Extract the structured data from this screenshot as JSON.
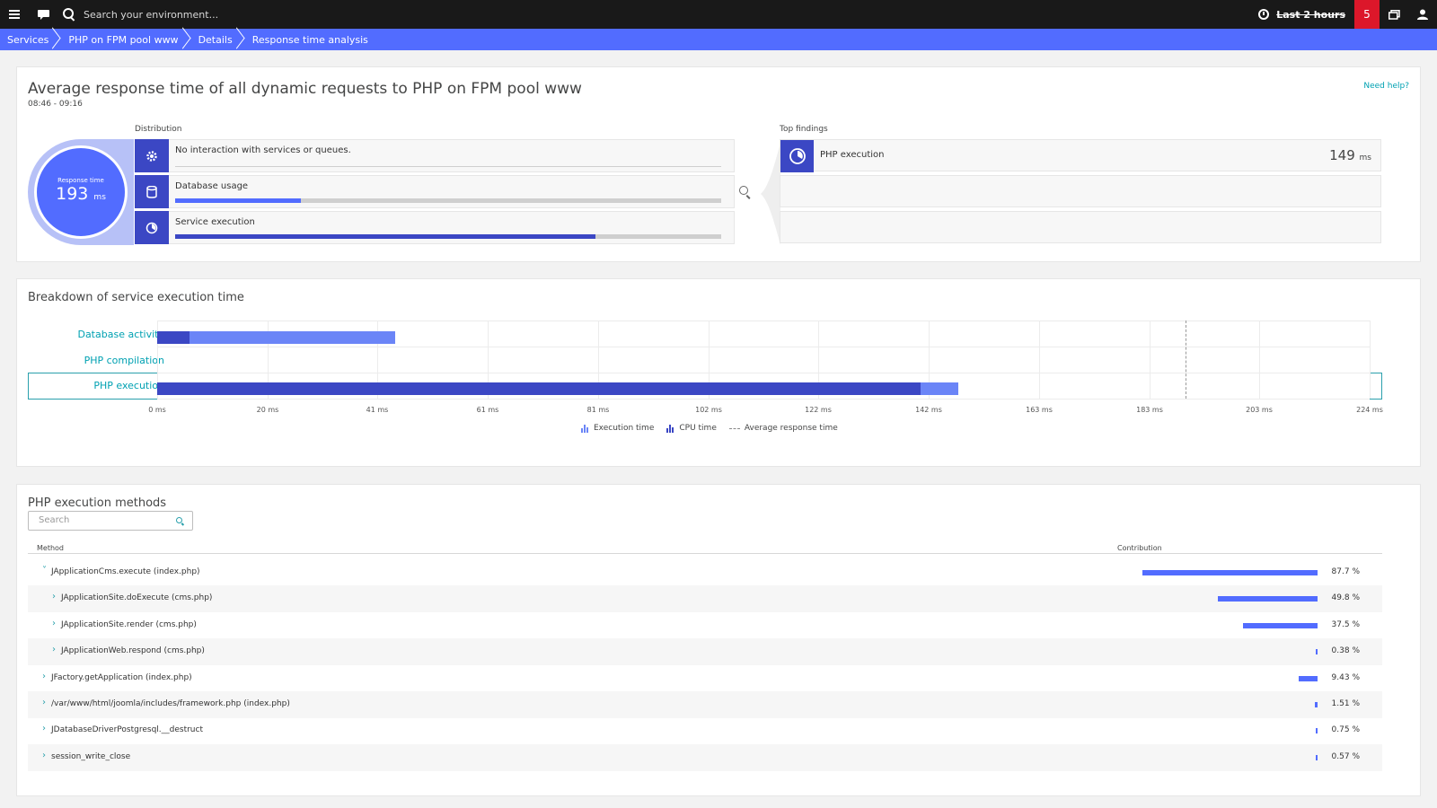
{
  "topbar": {
    "search_placeholder": "Search your environment...",
    "timeframe": "Last 2 hours",
    "problems_count": "5"
  },
  "breadcrumb": [
    "Services",
    "PHP on FPM pool www",
    "Details",
    "Response time analysis"
  ],
  "summary": {
    "title": "Average response time of all dynamic requests to PHP on FPM pool www",
    "time_range": "08:46 - 09:16",
    "help_link": "Need help?",
    "response_time_label": "Response time",
    "response_time_value": "193",
    "response_time_unit": "ms",
    "distribution_label": "Distribution",
    "distribution": [
      {
        "label": "No interaction with services or queues.",
        "icon": "gear-icon",
        "fraction": 0
      },
      {
        "label": "Database usage",
        "icon": "database-icon",
        "fraction": 0.23
      },
      {
        "label": "Service execution",
        "icon": "timer-icon",
        "fraction": 0.77
      }
    ],
    "top_findings_label": "Top findings",
    "top_findings": [
      {
        "label": "PHP execution",
        "value": "149",
        "unit": "ms",
        "icon": "timer-icon"
      }
    ]
  },
  "breakdown": {
    "title": "Breakdown of service execution time",
    "chart_data": {
      "type": "bar",
      "orientation": "horizontal",
      "stacked": true,
      "categories": [
        "Database activity",
        "PHP compilation",
        "PHP execution"
      ],
      "series": [
        {
          "name": "Execution time",
          "color": "#3b47c4",
          "values": [
            6,
            0,
            141
          ]
        },
        {
          "name": "CPU time",
          "color": "#6b85f7",
          "values": [
            38,
            0,
            7
          ]
        }
      ],
      "avg_response_time": 190,
      "xlim": [
        0,
        224
      ],
      "x_ticks": [
        "0 ms",
        "20 ms",
        "41 ms",
        "61 ms",
        "81 ms",
        "102 ms",
        "122 ms",
        "142 ms",
        "163 ms",
        "183 ms",
        "203 ms",
        "224 ms"
      ],
      "selected_category": "PHP execution",
      "legend": [
        "Execution time",
        "CPU time",
        "Average response time"
      ],
      "legend_position": "bottom"
    }
  },
  "methods": {
    "title": "PHP execution methods",
    "search_placeholder": "Search",
    "col_method": "Method",
    "col_contribution": "Contribution",
    "rows": [
      {
        "name": "JApplicationCms.execute (index.php)",
        "pct": "87.7 %",
        "value": 87.7,
        "level": 0,
        "expanded": true
      },
      {
        "name": "JApplicationSite.doExecute (cms.php)",
        "pct": "49.8 %",
        "value": 49.8,
        "level": 1,
        "expanded": false
      },
      {
        "name": "JApplicationSite.render (cms.php)",
        "pct": "37.5 %",
        "value": 37.5,
        "level": 1,
        "expanded": false
      },
      {
        "name": "JApplicationWeb.respond (cms.php)",
        "pct": "0.38 %",
        "value": 0.38,
        "level": 1,
        "expanded": false
      },
      {
        "name": "JFactory.getApplication (index.php)",
        "pct": "9.43 %",
        "value": 9.43,
        "level": 0,
        "expanded": false
      },
      {
        "name": "/var/www/html/joomla/includes/framework.php (index.php)",
        "pct": "1.51 %",
        "value": 1.51,
        "level": 0,
        "expanded": false
      },
      {
        "name": "JDatabaseDriverPostgresql.__destruct",
        "pct": "0.75 %",
        "value": 0.75,
        "level": 0,
        "expanded": false
      },
      {
        "name": "session_write_close",
        "pct": "0.57 %",
        "value": 0.57,
        "level": 0,
        "expanded": false
      }
    ]
  }
}
